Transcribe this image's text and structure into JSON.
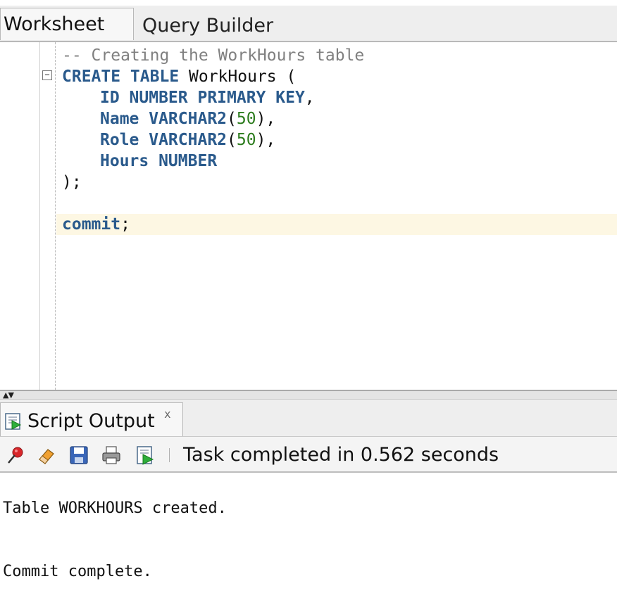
{
  "tabs": {
    "worksheet": "Worksheet",
    "query_builder": "Query Builder"
  },
  "editor": {
    "lines": {
      "comment": "-- Creating the WorkHours table",
      "create_kw": "CREATE TABLE",
      "table_name": " WorkHours (",
      "id_kw": "ID NUMBER PRIMARY KEY",
      "id_end": ",",
      "name_kw": "Name VARCHAR2",
      "name_paren_open": "(",
      "name_len": "50",
      "name_end": "),",
      "role_kw": "Role VARCHAR2",
      "role_paren_open": "(",
      "role_len": "50",
      "role_end": "),",
      "hours_kw": "Hours NUMBER",
      "close": ");",
      "commit_kw": "commit",
      "commit_end": ";"
    },
    "fold_symbol": "−"
  },
  "output_panel": {
    "tab_label": "Script Output",
    "close_symbol": "x",
    "icons": [
      "pin-icon",
      "eraser-icon",
      "save-icon",
      "print-icon",
      "run-script-icon"
    ],
    "status": "Task completed in 0.562 seconds",
    "messages": [
      "Table WORKHOURS created.",
      "Commit complete."
    ]
  },
  "colors": {
    "keyword": "#2a5a8c",
    "comment": "#808080",
    "number": "#2e7d1f",
    "current_line": "#fdf7e3"
  }
}
